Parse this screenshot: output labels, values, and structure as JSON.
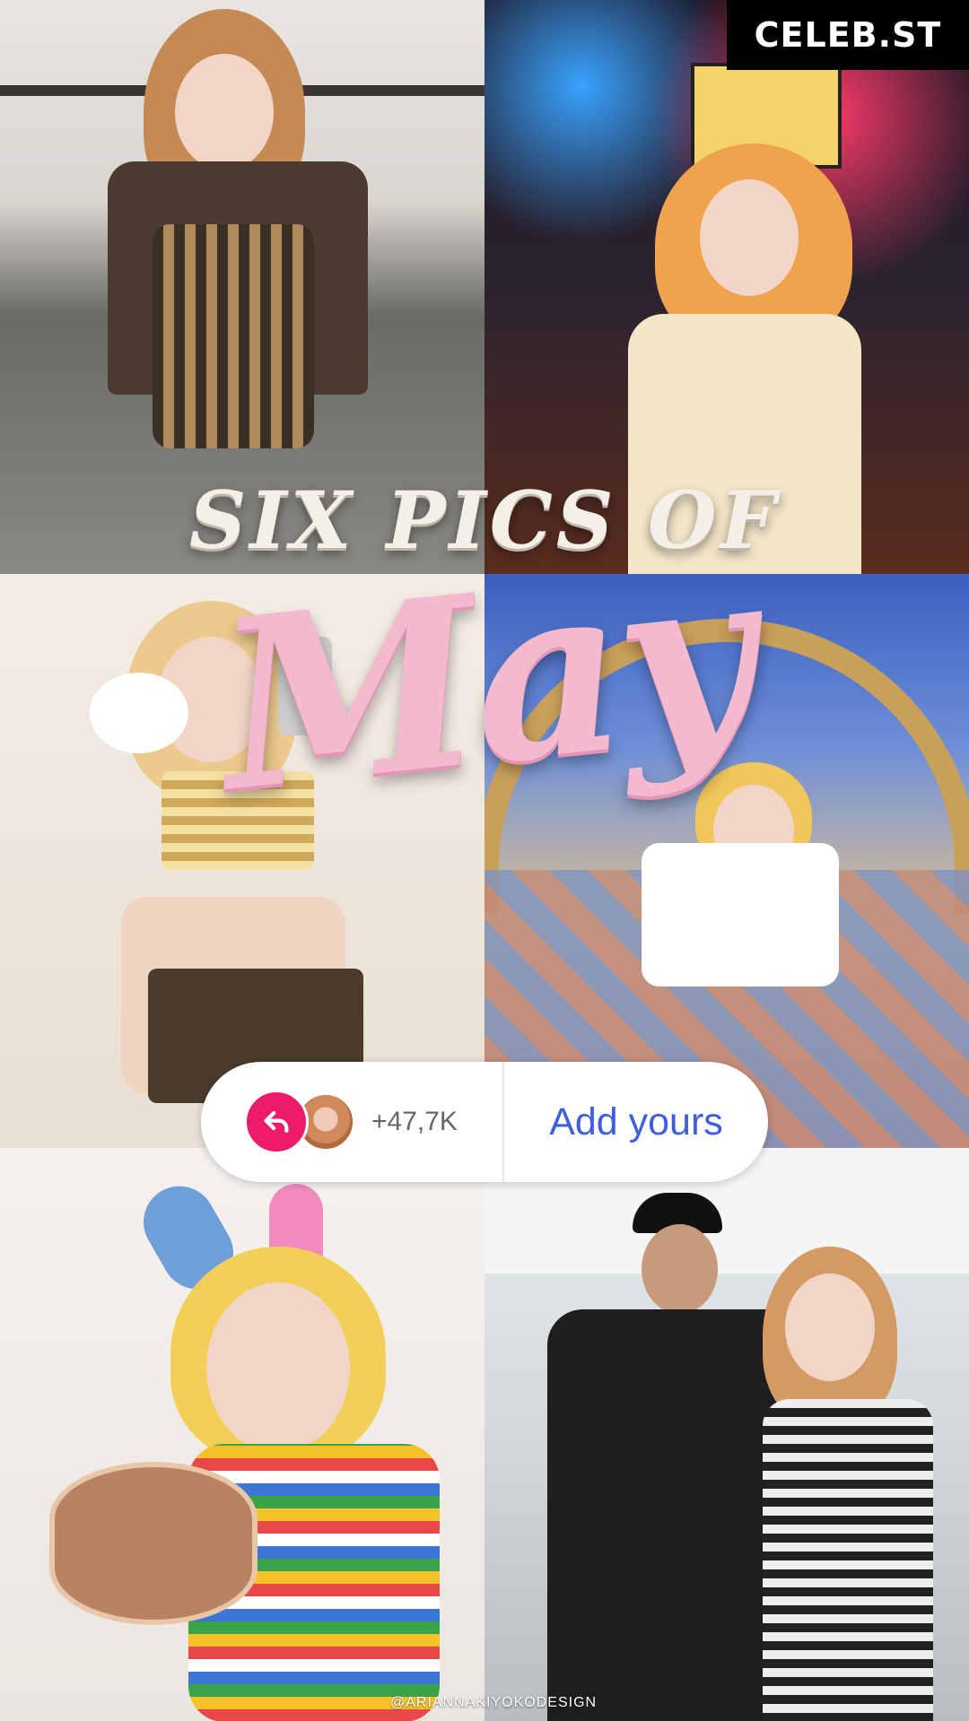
{
  "brand": {
    "label": "CELEB.ST"
  },
  "title": {
    "line1": "SIX PICS OF",
    "line2": "May"
  },
  "sticker": {
    "count": "+47,7K",
    "action_label": "Add yours"
  },
  "credit": {
    "text": "@ARIANNAKIYOKODESIGN"
  },
  "photos": [
    {
      "name": "photo-1"
    },
    {
      "name": "photo-2"
    },
    {
      "name": "photo-3"
    },
    {
      "name": "photo-4"
    },
    {
      "name": "photo-5"
    },
    {
      "name": "photo-6"
    }
  ],
  "colors": {
    "accent_pink": "#ee1b6a",
    "accent_blue": "#3f5fe0",
    "title_pink": "#f2b9cf"
  }
}
